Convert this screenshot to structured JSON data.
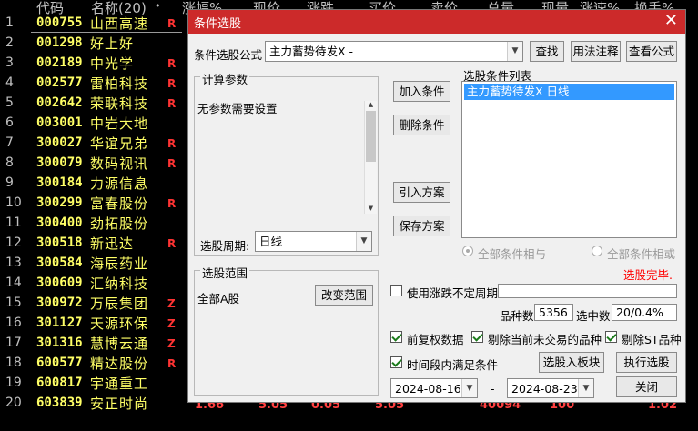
{
  "table": {
    "headers": [
      "代码",
      "名称(20)",
      "•",
      "涨幅%",
      "现价",
      "涨跌",
      "买价",
      "卖价",
      "总量",
      "现量",
      "涨速%",
      "换手%"
    ],
    "rows": [
      {
        "num": "1",
        "code": "000755",
        "name": "山西高速",
        "flag": "R"
      },
      {
        "num": "2",
        "code": "001298",
        "name": "好上好",
        "flag": ""
      },
      {
        "num": "3",
        "code": "002189",
        "name": "中光学",
        "flag": "R"
      },
      {
        "num": "4",
        "code": "002577",
        "name": "雷柏科技",
        "flag": "R"
      },
      {
        "num": "5",
        "code": "002642",
        "name": "荣联科技",
        "flag": "R"
      },
      {
        "num": "6",
        "code": "003001",
        "name": "中岩大地",
        "flag": ""
      },
      {
        "num": "7",
        "code": "300027",
        "name": "华谊兄弟",
        "flag": "R"
      },
      {
        "num": "8",
        "code": "300079",
        "name": "数码视讯",
        "flag": "R"
      },
      {
        "num": "9",
        "code": "300184",
        "name": "力源信息",
        "flag": ""
      },
      {
        "num": "10",
        "code": "300299",
        "name": "富春股份",
        "flag": "R"
      },
      {
        "num": "11",
        "code": "300400",
        "name": "劲拓股份",
        "flag": ""
      },
      {
        "num": "12",
        "code": "300518",
        "name": "新迅达",
        "flag": "R"
      },
      {
        "num": "13",
        "code": "300584",
        "name": "海辰药业",
        "flag": ""
      },
      {
        "num": "14",
        "code": "300609",
        "name": "汇纳科技",
        "flag": ""
      },
      {
        "num": "15",
        "code": "300972",
        "name": "万辰集团",
        "flag": "Z"
      },
      {
        "num": "16",
        "code": "301127",
        "name": "天源环保",
        "flag": "Z"
      },
      {
        "num": "17",
        "code": "301316",
        "name": "慧博云通",
        "flag": "Z"
      },
      {
        "num": "18",
        "code": "600577",
        "name": "精达股份",
        "flag": "R"
      },
      {
        "num": "19",
        "code": "600817",
        "name": "宇通重工",
        "flag": ""
      },
      {
        "num": "20",
        "code": "603839",
        "name": "安正时尚",
        "flag": ""
      }
    ],
    "bottom_values": [
      "1.66",
      "5.05",
      "0.05",
      "5.05",
      "40094",
      "100",
      "1.02"
    ]
  },
  "dialog": {
    "title": "条件选股",
    "close_glyph": "✕",
    "formula_label": "条件选股公式",
    "formula_value": "主力蓄势待发X  -",
    "find_btn": "查找",
    "usage_btn": "用法注释",
    "view_formula_btn": "查看公式",
    "calc_params_title": "计算参数",
    "no_params_text": "无参数需要设置",
    "period_label": "选股周期:",
    "period_value": "日线",
    "add_condition_btn": "加入条件",
    "delete_condition_btn": "删除条件",
    "import_plan_btn": "引入方案",
    "save_plan_btn": "保存方案",
    "condition_list_label": "选股条件列表",
    "conditions": [
      "主力蓄势待发X  日线"
    ],
    "radio_and": "全部条件相与",
    "radio_or": "全部条件相或",
    "status_text": "选股完毕.",
    "range_title": "选股范围",
    "range_value": "全部A股",
    "change_range_btn": "改变范围",
    "use_irregular_period": "使用涨跌不定周期",
    "variety_count_label": "品种数",
    "variety_count": "5356",
    "selected_label": "选中数",
    "selected_value": "20/0.4%",
    "pre_adjust": "前复权数据",
    "exclude_untraded": "剔除当前未交易的品种",
    "exclude_st": "剔除ST品种",
    "within_period": "时间段内满足条件",
    "to_board_btn": "选股入板块",
    "execute_btn": "执行选股",
    "date_from": "2024-08-16",
    "date_sep": "-",
    "date_to": "2024-08-23",
    "close_btn": "关闭",
    "colors": {
      "title_bar": "#cc2a2a",
      "selection": "#3399ff",
      "status": "#ff0000"
    }
  }
}
